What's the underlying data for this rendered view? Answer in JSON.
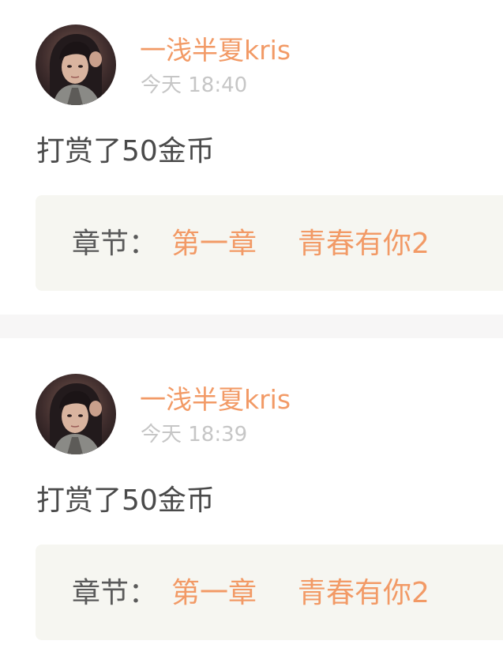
{
  "feed": {
    "items": [
      {
        "user": {
          "name": "一浅半夏kris",
          "avatar": "user-avatar-photo"
        },
        "time": "今天 18:40",
        "message": "打赏了50金币",
        "chapter": {
          "label": "章节：",
          "name": "第一章",
          "title": "青春有你2"
        }
      },
      {
        "user": {
          "name": "一浅半夏kris",
          "avatar": "user-avatar-photo"
        },
        "time": "今天 18:39",
        "message": "打赏了50金币",
        "chapter": {
          "label": "章节：",
          "name": "第一章",
          "title": "青春有你2"
        }
      }
    ]
  },
  "colors": {
    "accent": "#f29a66",
    "text": "#4a4a4a",
    "muted": "#c6c6c6",
    "chapter_bg": "#f6f6f1",
    "divider": "#f7f6f6"
  }
}
